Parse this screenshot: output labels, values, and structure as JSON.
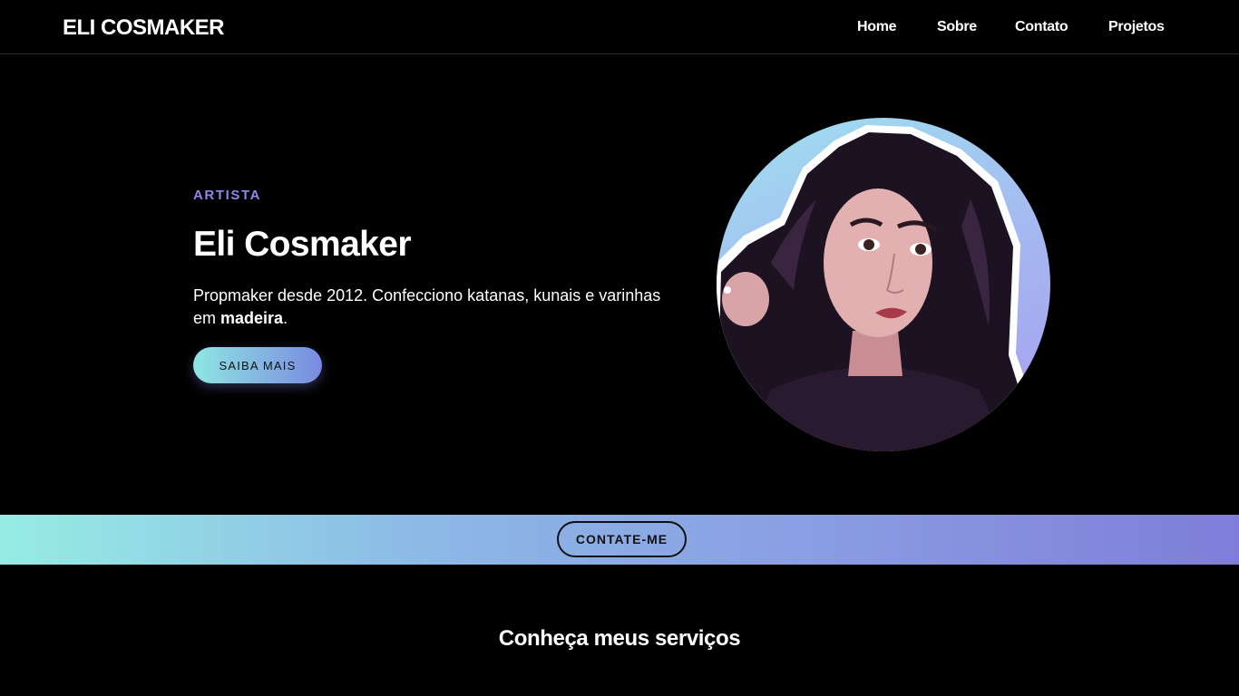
{
  "nav": {
    "brand": "ELI COSMAKER",
    "links": [
      "Home",
      "Sobre",
      "Contato",
      "Projetos"
    ]
  },
  "hero": {
    "eyebrow": "ARTISTA",
    "title": "Eli Cosmaker",
    "description_prefix": "Propmaker desde 2012. Confecciono katanas, kunais e varinhas em ",
    "description_bold": "madeira",
    "description_suffix": ".",
    "button_label": "SAIBA MAIS"
  },
  "band": {
    "button_label": "CONTATE-ME"
  },
  "services": {
    "title": "Conheça meus serviços"
  },
  "colors": {
    "accent": "#8f86e8",
    "gradient_start": "#96ece4",
    "gradient_end": "#7f7dd8"
  }
}
